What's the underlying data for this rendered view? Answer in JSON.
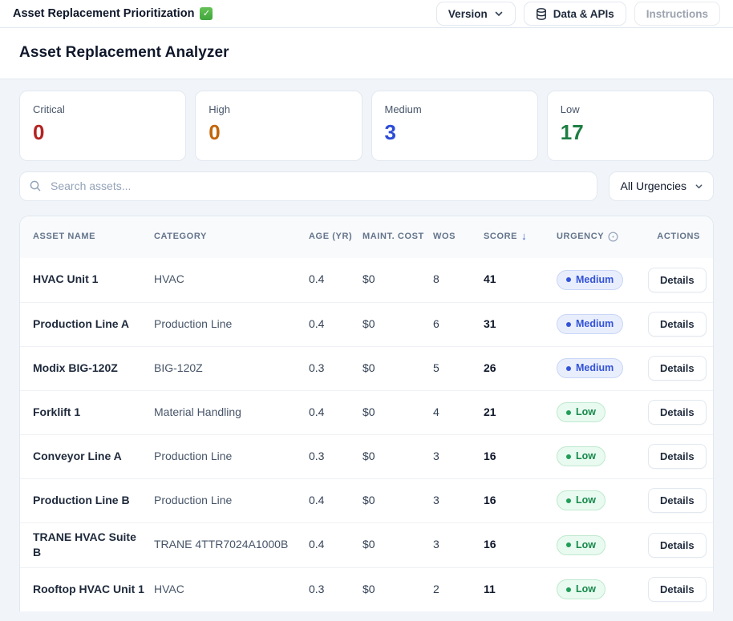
{
  "topbar": {
    "title": "Asset Replacement Prioritization",
    "check_glyph": "✓",
    "version_label": "Version",
    "data_apis_label": "Data & APIs",
    "instructions_label": "Instructions"
  },
  "page": {
    "title": "Asset Replacement Analyzer"
  },
  "summary_cards": [
    {
      "label": "Critical",
      "value": "0",
      "color": "#b32323"
    },
    {
      "label": "High",
      "value": "0",
      "color": "#c2660a"
    },
    {
      "label": "Medium",
      "value": "3",
      "color": "#2d4cd6"
    },
    {
      "label": "Low",
      "value": "17",
      "color": "#1e7e43"
    }
  ],
  "filters": {
    "search_placeholder": "Search assets...",
    "urgency_selected": "All Urgencies"
  },
  "table": {
    "columns": [
      {
        "label": "ASSET NAME"
      },
      {
        "label": "CATEGORY"
      },
      {
        "label": "AGE (YR)"
      },
      {
        "label": "MAINT. COST"
      },
      {
        "label": "WOS"
      },
      {
        "label": "SCORE",
        "sort": "desc",
        "sort_glyph": "↓"
      },
      {
        "label": "URGENCY",
        "info": true
      },
      {
        "label": "ACTIONS"
      }
    ],
    "details_label": "Details",
    "rows": [
      {
        "name": "HVAC Unit 1",
        "category": "HVAC",
        "age": "0.4",
        "cost": "$0",
        "wos": "8",
        "score": "41",
        "urgency": "Medium"
      },
      {
        "name": "Production Line A",
        "category": "Production Line",
        "age": "0.4",
        "cost": "$0",
        "wos": "6",
        "score": "31",
        "urgency": "Medium"
      },
      {
        "name": "Modix BIG-120Z",
        "category": "BIG-120Z",
        "age": "0.3",
        "cost": "$0",
        "wos": "5",
        "score": "26",
        "urgency": "Medium"
      },
      {
        "name": "Forklift 1",
        "category": "Material Handling",
        "age": "0.4",
        "cost": "$0",
        "wos": "4",
        "score": "21",
        "urgency": "Low"
      },
      {
        "name": "Conveyor Line A",
        "category": "Production Line",
        "age": "0.3",
        "cost": "$0",
        "wos": "3",
        "score": "16",
        "urgency": "Low"
      },
      {
        "name": "Production Line B",
        "category": "Production Line",
        "age": "0.4",
        "cost": "$0",
        "wos": "3",
        "score": "16",
        "urgency": "Low"
      },
      {
        "name": "TRANE HVAC Suite B",
        "category": "TRANE 4TTR7024A1000B",
        "age": "0.4",
        "cost": "$0",
        "wos": "3",
        "score": "16",
        "urgency": "Low"
      },
      {
        "name": "Rooftop HVAC Unit 1",
        "category": "HVAC",
        "age": "0.3",
        "cost": "$0",
        "wos": "2",
        "score": "11",
        "urgency": "Low"
      }
    ]
  }
}
